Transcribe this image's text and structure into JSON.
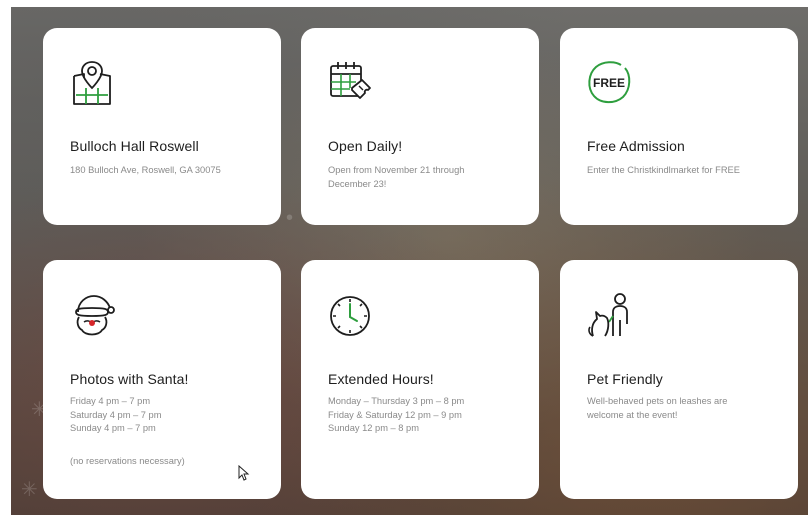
{
  "colors": {
    "accent_green": "#2e9e3e",
    "icon_dark": "#1e1e1e",
    "santa_red": "#d6262a",
    "card_bg": "#ffffff"
  },
  "cards": [
    {
      "icon": "map-location-icon",
      "title": "Bulloch Hall Roswell",
      "lines": [
        "180 Bulloch Ave, Roswell, GA 30075"
      ]
    },
    {
      "icon": "calendar-ticket-icon",
      "title": "Open Daily!",
      "lines": [
        "Open from November 21 through",
        "December 23!"
      ]
    },
    {
      "icon": "free-badge-icon",
      "icon_text": "FREE",
      "title": "Free Admission",
      "lines": [
        "Enter the Christkindlmarket for FREE"
      ]
    },
    {
      "icon": "santa-icon",
      "title": "Photos with Santa!",
      "lines": [
        "Friday 4 pm – 7 pm",
        "Saturday 4 pm – 7 pm",
        "Sunday 4 pm – 7 pm"
      ],
      "note": "(no reservations necessary)"
    },
    {
      "icon": "clock-icon",
      "title": "Extended Hours!",
      "lines": [
        "Monday – Thursday 3 pm – 8 pm",
        "Friday & Saturday 12 pm – 9 pm",
        "Sunday 12 pm – 8 pm"
      ]
    },
    {
      "icon": "person-with-pet-icon",
      "title": "Pet Friendly",
      "lines": [
        "Well-behaved pets on leashes are",
        "welcome at the event!"
      ]
    }
  ]
}
